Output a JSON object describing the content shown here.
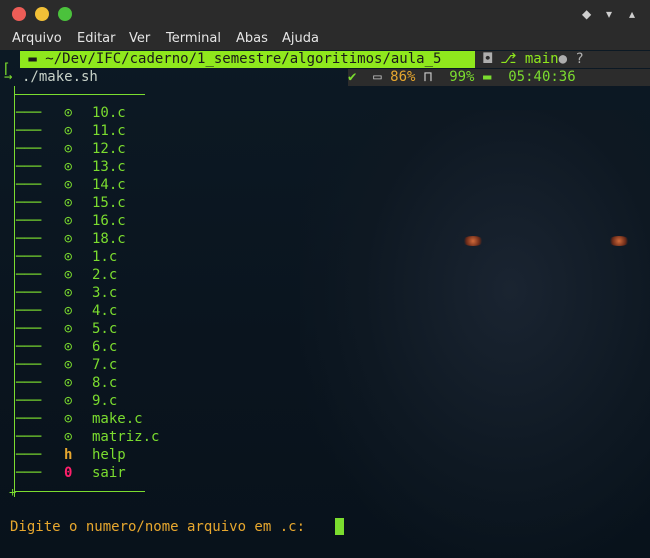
{
  "window": {
    "controls": [
      "close",
      "minimize",
      "maximize"
    ],
    "wm_buttons": [
      "◆",
      "▾",
      "▴"
    ]
  },
  "menu": [
    "Arquivo",
    "Editar",
    "Ver",
    "Terminal",
    "Abas",
    "Ajuda"
  ],
  "powerline": {
    "path": "~/Dev/IFC/caderno/1_semestre/algoritimos/aula_5",
    "branch": "main",
    "branch_icons": "● ?",
    "check": "✔",
    "battery": "86%",
    "memory": "99%",
    "time": "05:40:36"
  },
  "command": "./make.sh",
  "files": [
    {
      "icon": "⊙",
      "name": "10.c"
    },
    {
      "icon": "⊙",
      "name": "11.c"
    },
    {
      "icon": "⊙",
      "name": "12.c"
    },
    {
      "icon": "⊙",
      "name": "13.c"
    },
    {
      "icon": "⊙",
      "name": "14.c"
    },
    {
      "icon": "⊙",
      "name": "15.c"
    },
    {
      "icon": "⊙",
      "name": "16.c"
    },
    {
      "icon": "⊙",
      "name": "18.c"
    },
    {
      "icon": "⊙",
      "name": "1.c"
    },
    {
      "icon": "⊙",
      "name": "2.c"
    },
    {
      "icon": "⊙",
      "name": "3.c"
    },
    {
      "icon": "⊙",
      "name": "4.c"
    },
    {
      "icon": "⊙",
      "name": "5.c"
    },
    {
      "icon": "⊙",
      "name": "6.c"
    },
    {
      "icon": "⊙",
      "name": "7.c"
    },
    {
      "icon": "⊙",
      "name": "8.c"
    },
    {
      "icon": "⊙",
      "name": "9.c"
    },
    {
      "icon": "⊙",
      "name": "make.c"
    },
    {
      "icon": "⊙",
      "name": "matriz.c"
    },
    {
      "icon": "h",
      "name": "help",
      "color": "orange"
    },
    {
      "icon": "0",
      "name": "sair",
      "color": "red"
    }
  ],
  "prompt_text": "Digite o numero/nome arquivo em .c:"
}
